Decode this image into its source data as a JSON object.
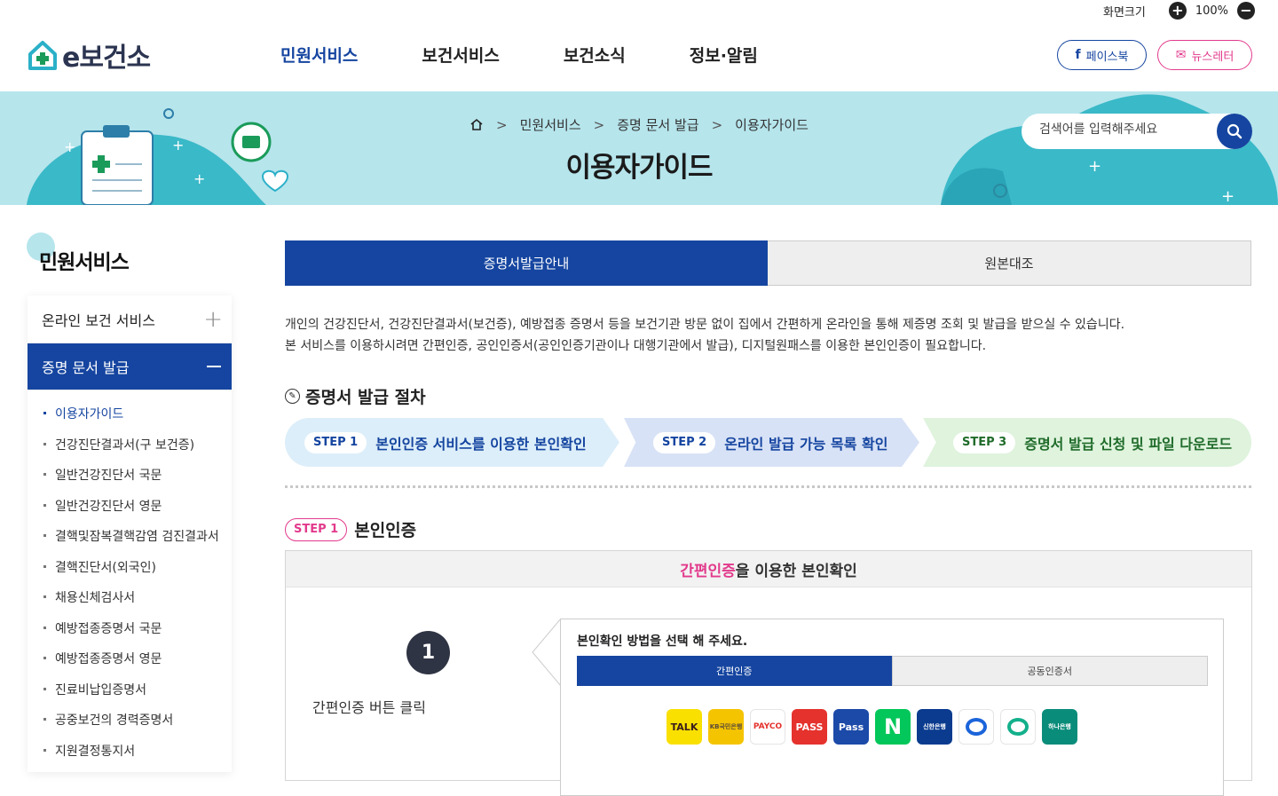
{
  "utility": {
    "screen_size_label": "화면크기",
    "zoom": "100%"
  },
  "header": {
    "logo_text": "e보건소",
    "nav": [
      {
        "label": "민원서비스",
        "active": true
      },
      {
        "label": "보건서비스",
        "active": false
      },
      {
        "label": "보건소식",
        "active": false
      },
      {
        "label": "정보·알림",
        "active": false
      }
    ],
    "facebook_label": "페이스북",
    "newsletter_label": "뉴스레터"
  },
  "banner": {
    "breadcrumb": [
      "민원서비스",
      "증명 문서 발급",
      "이용자가이드"
    ],
    "title": "이용자가이드",
    "search_placeholder": "검색어를 입력해주세요"
  },
  "sidebar": {
    "title": "민원서비스",
    "groups": [
      {
        "label": "온라인 보건 서비스",
        "expanded": false
      },
      {
        "label": "증명 문서 발급",
        "expanded": true
      }
    ],
    "sub_items": [
      {
        "label": "이용자가이드",
        "active": true
      },
      {
        "label": "건강진단결과서(구 보건증)"
      },
      {
        "label": "일반건강진단서 국문"
      },
      {
        "label": "일반건강진단서 영문"
      },
      {
        "label": "결핵및잠복결핵감염 검진결과서"
      },
      {
        "label": "결핵진단서(외국인)"
      },
      {
        "label": "채용신체검사서"
      },
      {
        "label": "예방접종증명서 국문"
      },
      {
        "label": "예방접종증명서 영문"
      },
      {
        "label": "진료비납입증명서"
      },
      {
        "label": "공중보건의 경력증명서"
      },
      {
        "label": "지원결정통지서"
      }
    ]
  },
  "main": {
    "tabs": [
      {
        "label": "증명서발급안내",
        "active": true
      },
      {
        "label": "원본대조",
        "active": false
      }
    ],
    "intro": [
      "개인의 건강진단서, 건강진단결과서(보건증), 예방접종 증명서 등을 보건기관 방문 없이 집에서 간편하게 온라인을 통해 제증명 조회 및 발급을 받으실 수 있습니다.",
      "본 서비스를 이용하시려면 간편인증, 공인인증서(공인인증기관이나 대행기관에서 발급), 디지털원패스를 이용한 본인인증이 필요합니다."
    ],
    "procedure_title": "증명서 발급 절차",
    "steps": [
      {
        "badge": "STEP 1",
        "text": "본인인증 서비스를 이용한 본인확인"
      },
      {
        "badge": "STEP 2",
        "text": "온라인 발급 가능 목록 확인"
      },
      {
        "badge": "STEP 3",
        "text": "증명서 발급 신청 및 파일 다운로드"
      }
    ],
    "step1": {
      "badge": "STEP 1",
      "title": "본인인증",
      "box_title_highlight": "간편인증",
      "box_title_rest": "을 이용한 본인확인",
      "number": "1",
      "instruction": "간편인증 버튼 클릭",
      "panel_title": "본인확인 방법을 선택 해 주세요.",
      "panel_tabs": [
        {
          "label": "간편인증",
          "active": true
        },
        {
          "label": "공동인증서",
          "active": false
        }
      ],
      "apps": [
        {
          "name": "kakao-talk",
          "label": "TALK",
          "bg": "#f9e000",
          "fg": "#3a1d1d"
        },
        {
          "name": "kb",
          "label": "KB국민은행",
          "bg": "#f5c400",
          "fg": "#5a4a3a"
        },
        {
          "name": "payco",
          "label": "PAYCO",
          "bg": "#ffffff",
          "fg": "#e5322d"
        },
        {
          "name": "pass",
          "label": "PASS",
          "bg": "#e5322d",
          "fg": "#ffffff"
        },
        {
          "name": "samsung-pass",
          "label": "Pass",
          "bg": "#1b4aa8",
          "fg": "#ffffff"
        },
        {
          "name": "naver",
          "label": "N",
          "bg": "#03c75a",
          "fg": "#ffffff"
        },
        {
          "name": "shinhan",
          "label": "신한은행",
          "bg": "#0a3b8f",
          "fg": "#ffffff"
        },
        {
          "name": "toss",
          "label": "",
          "bg": "#ffffff",
          "fg": "#1b64da"
        },
        {
          "name": "green-app",
          "label": "",
          "bg": "#ffffff",
          "fg": "#13b08b"
        },
        {
          "name": "hana",
          "label": "하나은행",
          "bg": "#0a8c7a",
          "fg": "#ffffff"
        }
      ]
    }
  },
  "colors": {
    "primary": "#1545a0",
    "accent_pink": "#e23a8c",
    "banner_bg": "#b6e5ec"
  }
}
